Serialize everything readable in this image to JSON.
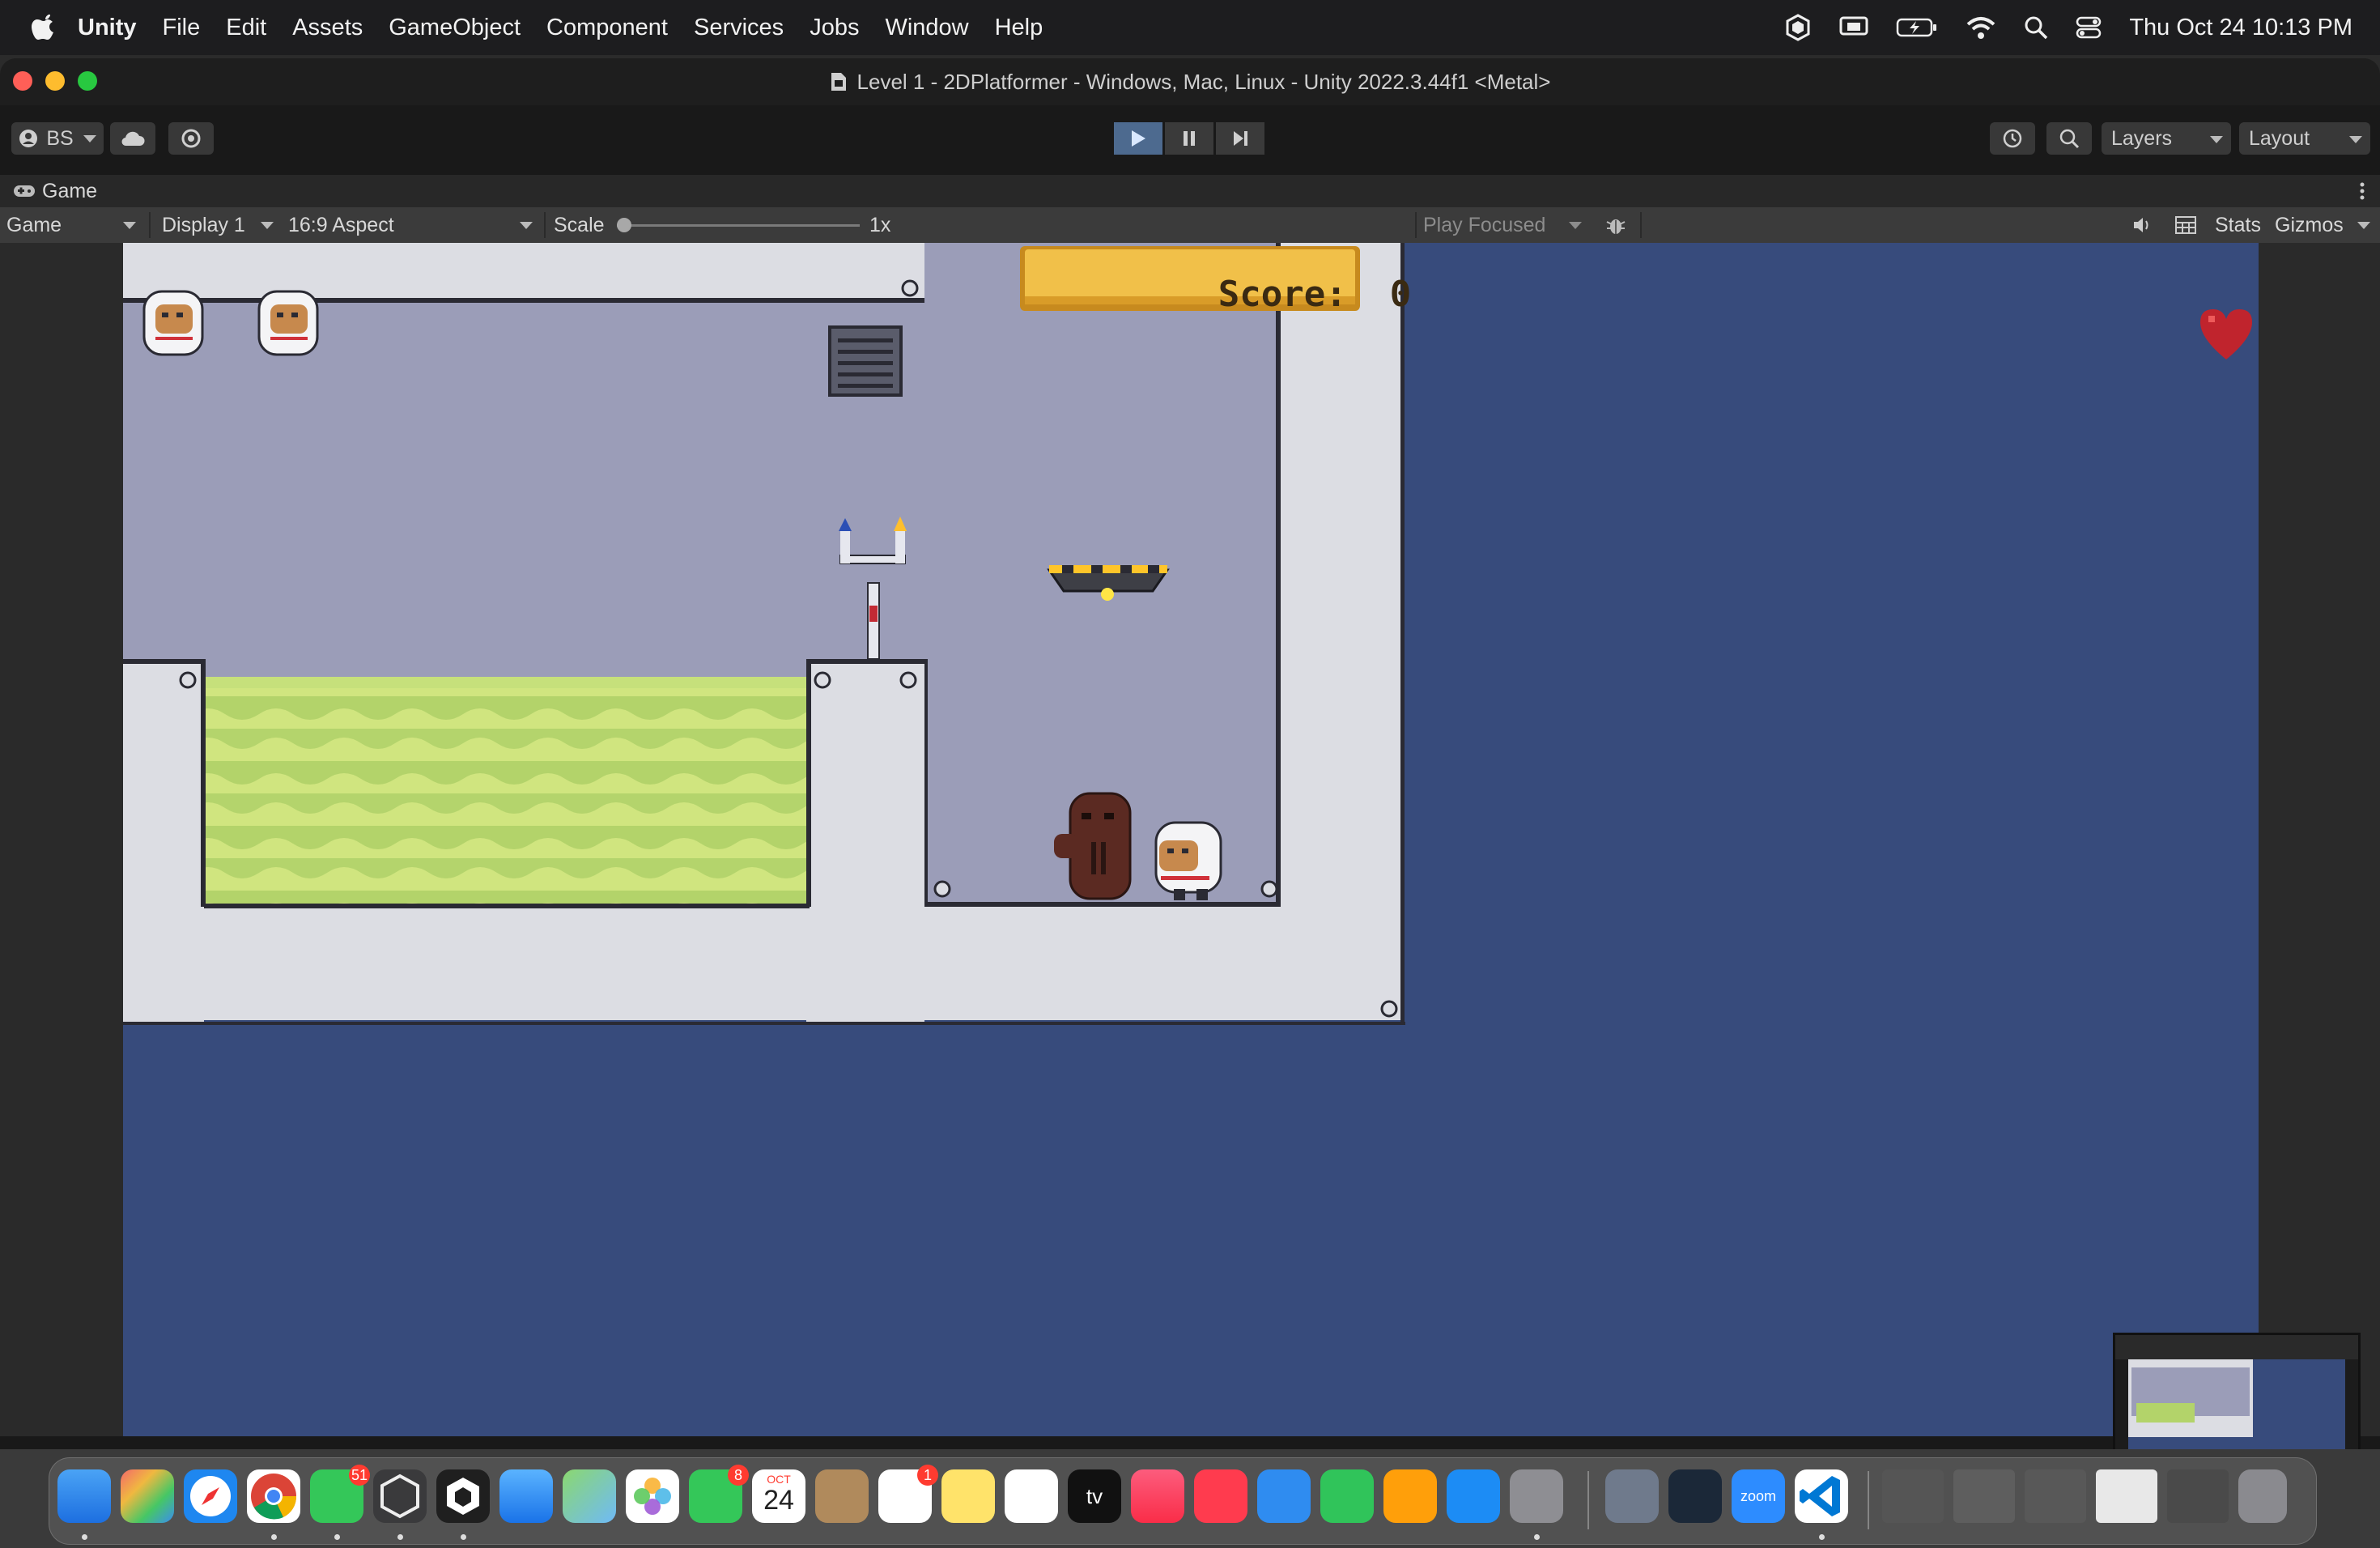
{
  "menubar": {
    "app_name": "Unity",
    "items": [
      "File",
      "Edit",
      "Assets",
      "GameObject",
      "Component",
      "Services",
      "Jobs",
      "Window",
      "Help"
    ],
    "datetime": "Thu Oct 24  10:13 PM"
  },
  "window": {
    "title": "Level 1 - 2DPlatformer - Windows, Mac, Linux - Unity 2022.3.44f1 <Metal>"
  },
  "toolbar": {
    "account_label": "BS",
    "layers_label": "Layers",
    "layout_label": "Layout"
  },
  "game_tab": {
    "label": "Game"
  },
  "game_bar": {
    "mode_label": "Game",
    "display_label": "Display 1",
    "aspect_label": "16:9 Aspect",
    "scale_label": "Scale",
    "scale_value": "1x",
    "play_focused_label": "Play Focused",
    "stats_label": "Stats",
    "gizmos_label": "Gizmos"
  },
  "game": {
    "score_text": "Score:  0",
    "lives_shown": 1
  },
  "dock": {
    "badges": {
      "messages": "51",
      "facetime": "8",
      "reminders": "1"
    },
    "calendar": {
      "month": "OCT",
      "day": "24"
    },
    "zoom_label": "zoom"
  },
  "colors": {
    "game_background": "#374b7c",
    "level_wall": "#dcdde3",
    "level_room": "#9b9db8",
    "grass": "#c6e07b",
    "score_plate": "#f1c049",
    "play_active": "#4d6a8f"
  }
}
